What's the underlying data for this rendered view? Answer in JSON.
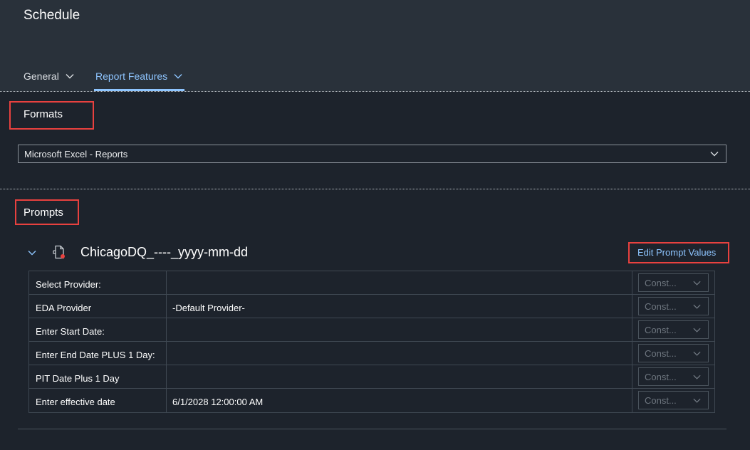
{
  "header": {
    "title": "Schedule",
    "tabs": [
      {
        "label": "General",
        "active": false
      },
      {
        "label": "Report Features",
        "active": true
      }
    ]
  },
  "formats": {
    "title": "Formats",
    "selected": "Microsoft Excel - Reports"
  },
  "prompts": {
    "title": "Prompts",
    "report_name": "ChicagoDQ_----_yyyy-mm-dd",
    "edit_link": "Edit Prompt Values",
    "rows": [
      {
        "label": "Select Provider:",
        "value": "",
        "type": "Const..."
      },
      {
        "label": "EDA Provider",
        "value": "-Default Provider-",
        "type": "Const..."
      },
      {
        "label": "Enter Start Date:",
        "value": "",
        "type": "Const..."
      },
      {
        "label": "Enter End Date PLUS 1 Day:",
        "value": "",
        "type": "Const..."
      },
      {
        "label": "PIT Date Plus 1 Day",
        "value": "",
        "type": "Const..."
      },
      {
        "label": "Enter effective date",
        "value": "6/1/2028 12:00:00 AM",
        "type": "Const..."
      }
    ]
  },
  "colors": {
    "accent": "#8ec5ff",
    "highlight_box": "#e8413f",
    "background": "#1d232c",
    "header_bg": "#29313a"
  },
  "icons": {
    "tab_chevron": "chevron-down-icon",
    "collapse": "chevron-down-icon",
    "report": "report-document-icon"
  }
}
